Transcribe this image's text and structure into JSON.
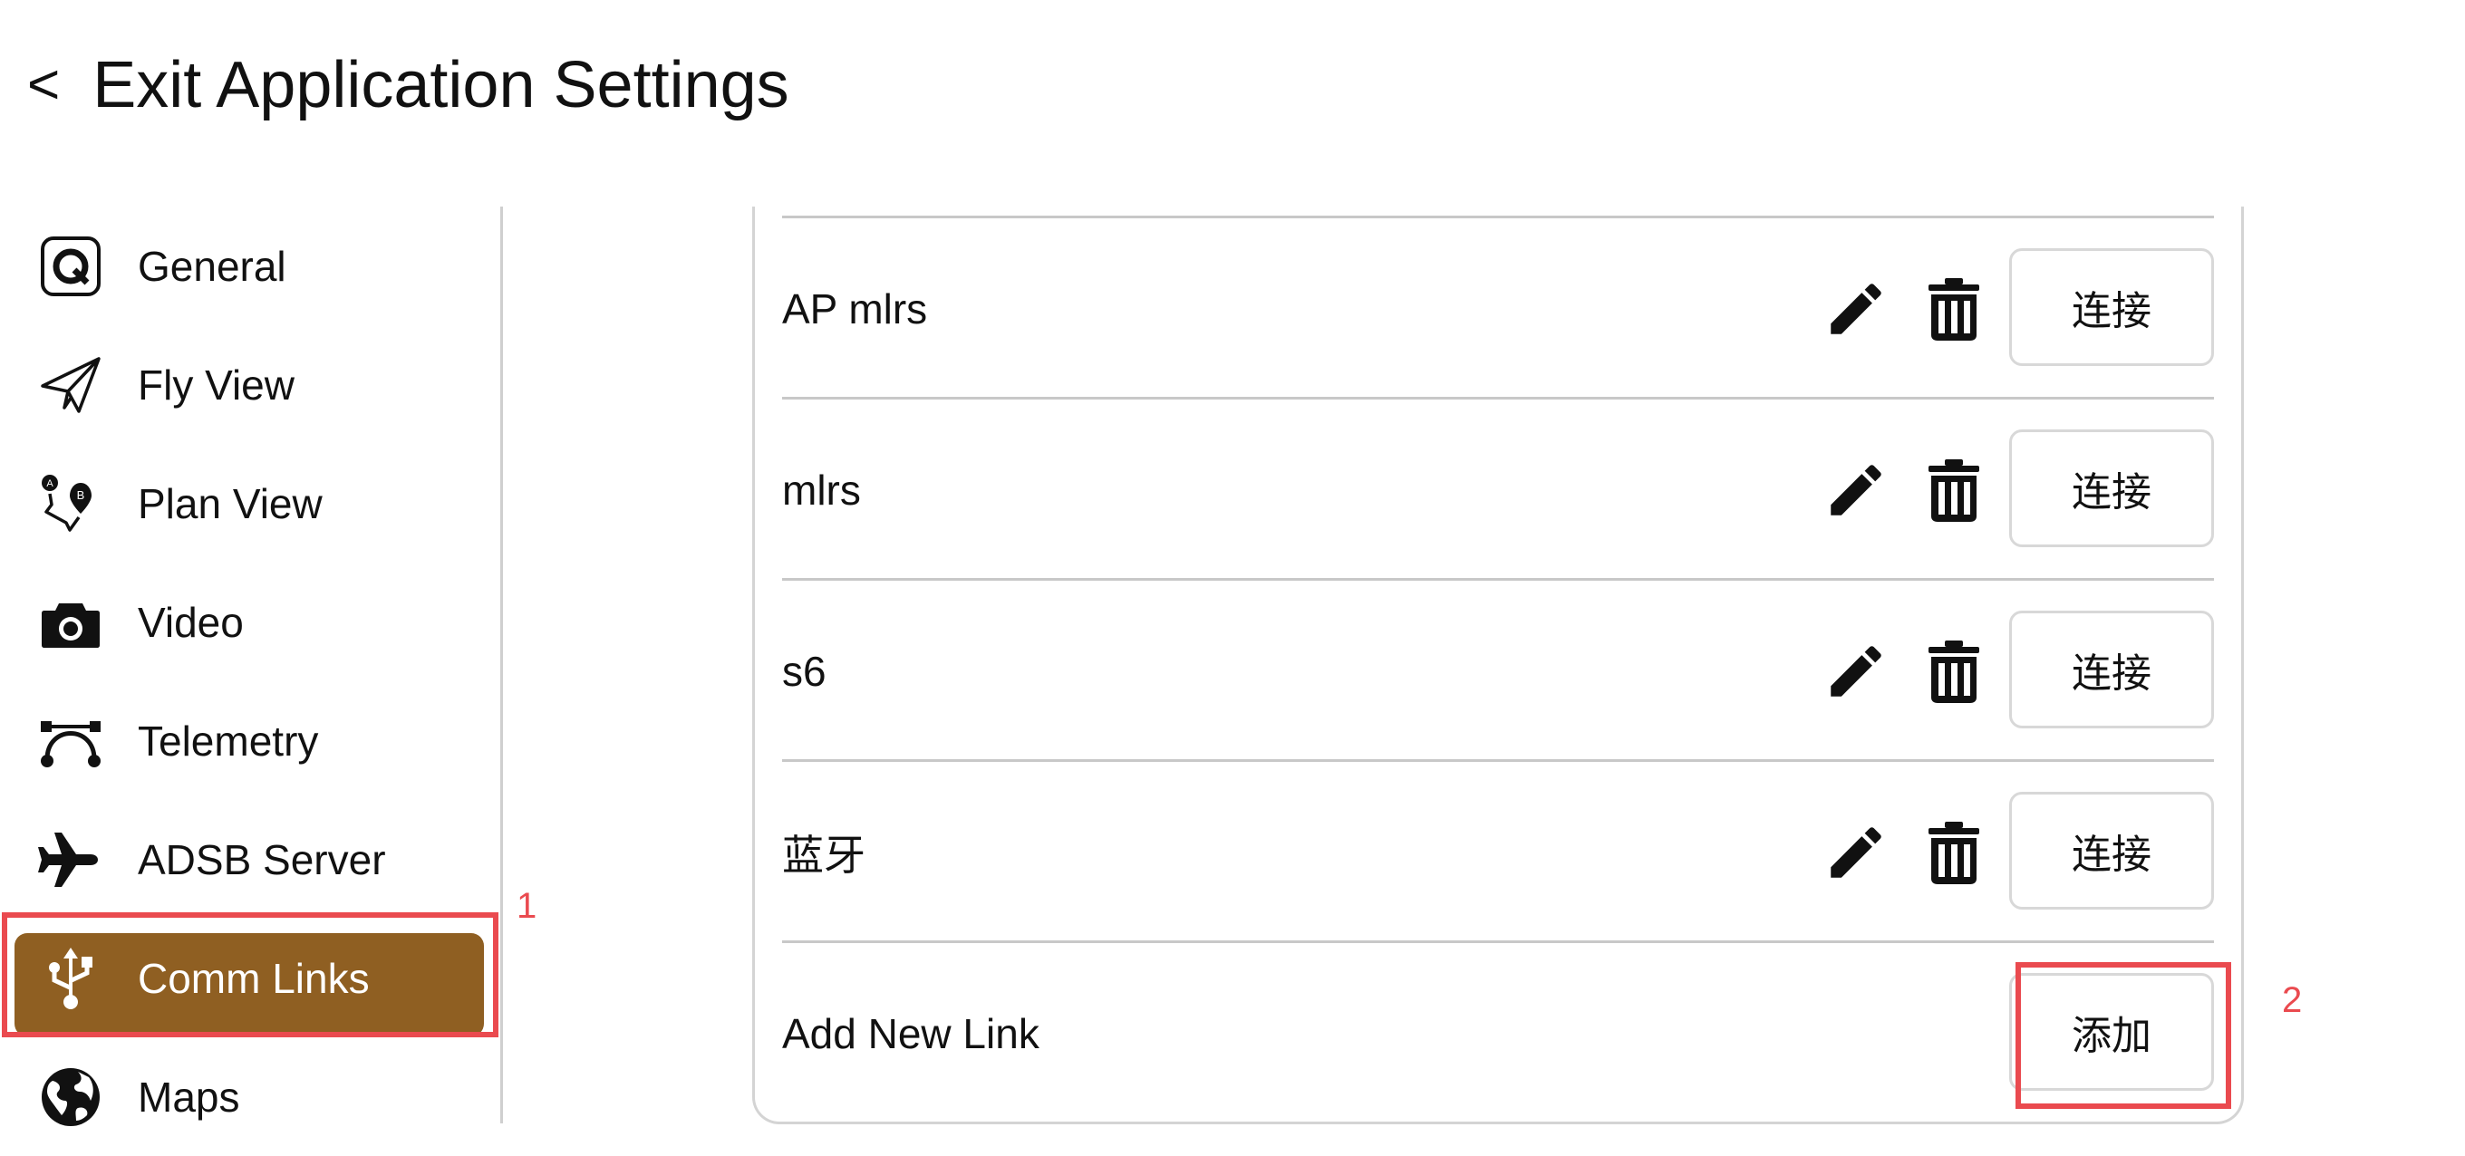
{
  "header": {
    "back_glyph": "<",
    "title": "Exit Application Settings"
  },
  "sidebar": {
    "items": [
      {
        "label": "General",
        "icon": "qgc-logo-icon"
      },
      {
        "label": "Fly View",
        "icon": "paper-plane-icon"
      },
      {
        "label": "Plan View",
        "icon": "route-a-b-icon"
      },
      {
        "label": "Video",
        "icon": "camera-icon"
      },
      {
        "label": "Telemetry",
        "icon": "bezier-curve-icon"
      },
      {
        "label": "ADSB Server",
        "icon": "airplane-icon"
      },
      {
        "label": "Comm Links",
        "icon": "usb-icon",
        "active": true
      },
      {
        "label": "Maps",
        "icon": "globe-icon"
      }
    ]
  },
  "links": {
    "rows": [
      {
        "name": "AP mlrs",
        "button": "连接"
      },
      {
        "name": "mlrs",
        "button": "连接"
      },
      {
        "name": "s6",
        "button": "连接"
      },
      {
        "name": "蓝牙",
        "button": "连接"
      }
    ],
    "add_row": {
      "name": "Add New Link",
      "button": "添加"
    }
  },
  "annotations": {
    "mark1": "1",
    "mark2": "2"
  },
  "colors": {
    "accent": "#8f5f22",
    "annotation": "#ea4a4f",
    "divider": "#c8c8c8"
  }
}
